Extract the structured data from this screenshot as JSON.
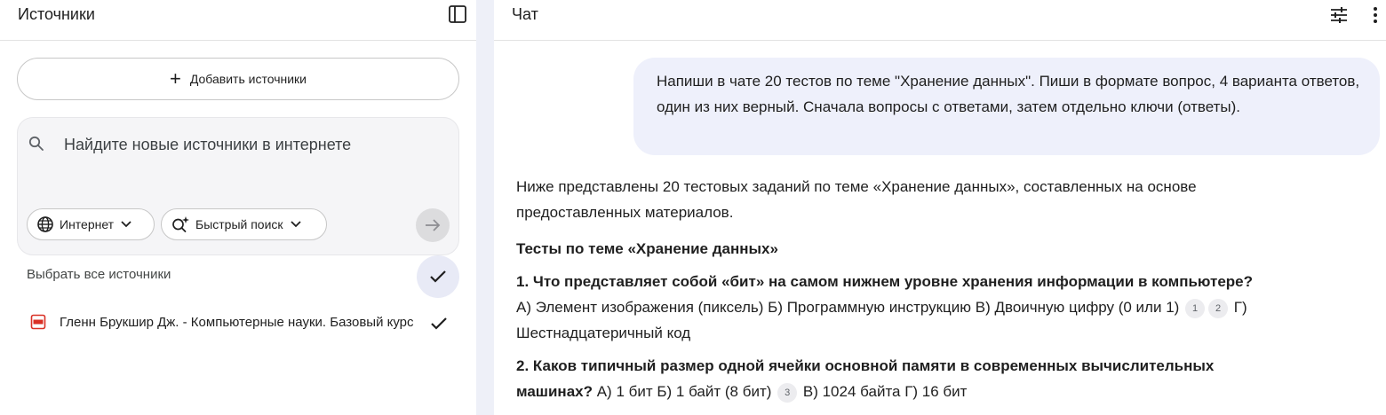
{
  "sources_panel": {
    "title": "Источники",
    "add_sources_label": "Добавить источники",
    "search": {
      "placeholder": "Найдите новые источники в интернете",
      "value": ""
    },
    "chips": {
      "internet_label": "Интернет",
      "fast_search_label": "Быстрый поиск"
    },
    "select_all_label": "Выбрать все источники",
    "sources": [
      {
        "title": "Гленн Брукшир Дж. - Компьютерные науки. Базовый курс",
        "type_icon": "pdf-icon",
        "checked": true
      }
    ],
    "icons": [
      "panel-toggle-icon",
      "plus-icon",
      "search-icon",
      "globe-icon",
      "sparkle-search-icon",
      "chevron-down-icon",
      "arrow-right-icon",
      "check-icon",
      "pdf-icon"
    ]
  },
  "chat_panel": {
    "title": "Чат",
    "icons": [
      "tune-icon",
      "more-vert-icon"
    ],
    "user_message": "Напиши в чате 20 тестов по теме \"Хранение данных\". Пиши в формате вопрос, 4 варианта ответов, один из них верный. Сначала вопросы с ответами, затем отдельно ключи (ответы).",
    "answer": {
      "intro": "Ниже представлены 20 тестовых заданий по теме «Хранение данных», составленных на основе предоставленных материалов.",
      "heading": "Тесты по теме «Хранение данных»",
      "q1": {
        "question": "1. Что представляет собой «бит» на самом нижнем уровне хранения информации в компьютере?",
        "answers_before_cite": " А) Элемент изображения (пиксель) Б) Программную инструкцию В) Двоичную цифру (0 или 1)",
        "cite_a": "1",
        "cite_b": "2",
        "answers_after_cite": " Г) Шестнадцатеричный код"
      },
      "q2": {
        "question": "2. Каков типичный размер одной ячейки основной памяти в современных вычислительных машинах?",
        "answers_before_cite": " А) 1 бит Б) 1 байт (8 бит)",
        "cite": "3",
        "answers_after_cite": " В) 1024 байта Г) 16 бит"
      }
    }
  },
  "colors": {
    "accent_bubble": "#eef0fb",
    "divider": "#eef0f8",
    "pdf_red": "#d93025",
    "search_box_bg": "#f5f5f7"
  }
}
